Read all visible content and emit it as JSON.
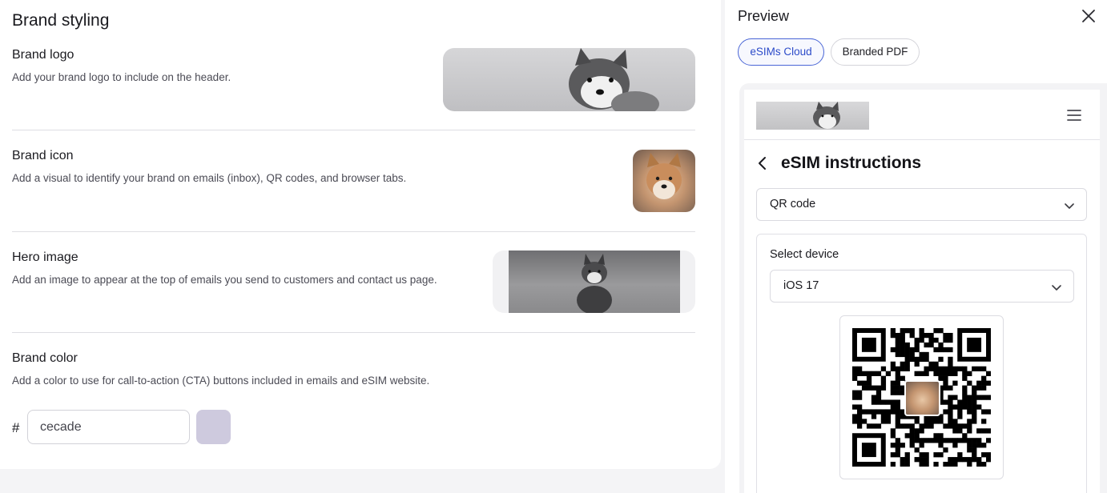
{
  "settings": {
    "title": "Brand styling",
    "brand_logo": {
      "title": "Brand logo",
      "description": "Add your brand logo to include on the header."
    },
    "brand_icon": {
      "title": "Brand icon",
      "description": "Add a visual to identify your brand on emails (inbox), QR codes, and browser tabs."
    },
    "hero_image": {
      "title": "Hero image",
      "description": "Add an image to appear at the top of emails you send to customers and contact us page."
    },
    "brand_color": {
      "title": "Brand color",
      "description": "Add a color to use for call-to-action (CTA) buttons included in emails and eSIM website.",
      "prefix": "#",
      "value": "cecade",
      "swatch_color": "#cecade"
    }
  },
  "preview": {
    "title": "Preview",
    "tabs": [
      {
        "label": "eSIMs Cloud",
        "active": true
      },
      {
        "label": "Branded PDF",
        "active": false
      }
    ],
    "phone": {
      "heading": "eSIM instructions",
      "method_dropdown": "QR code",
      "device_label": "Select device",
      "device_dropdown": "iOS 17"
    }
  },
  "icons": {
    "close": "close-icon",
    "menu": "hamburger-menu-icon",
    "back": "chevron-left-icon",
    "dropdown": "chevron-down-icon"
  },
  "colors": {
    "accent": "#4a66d6",
    "brand_color": "#cecade"
  }
}
